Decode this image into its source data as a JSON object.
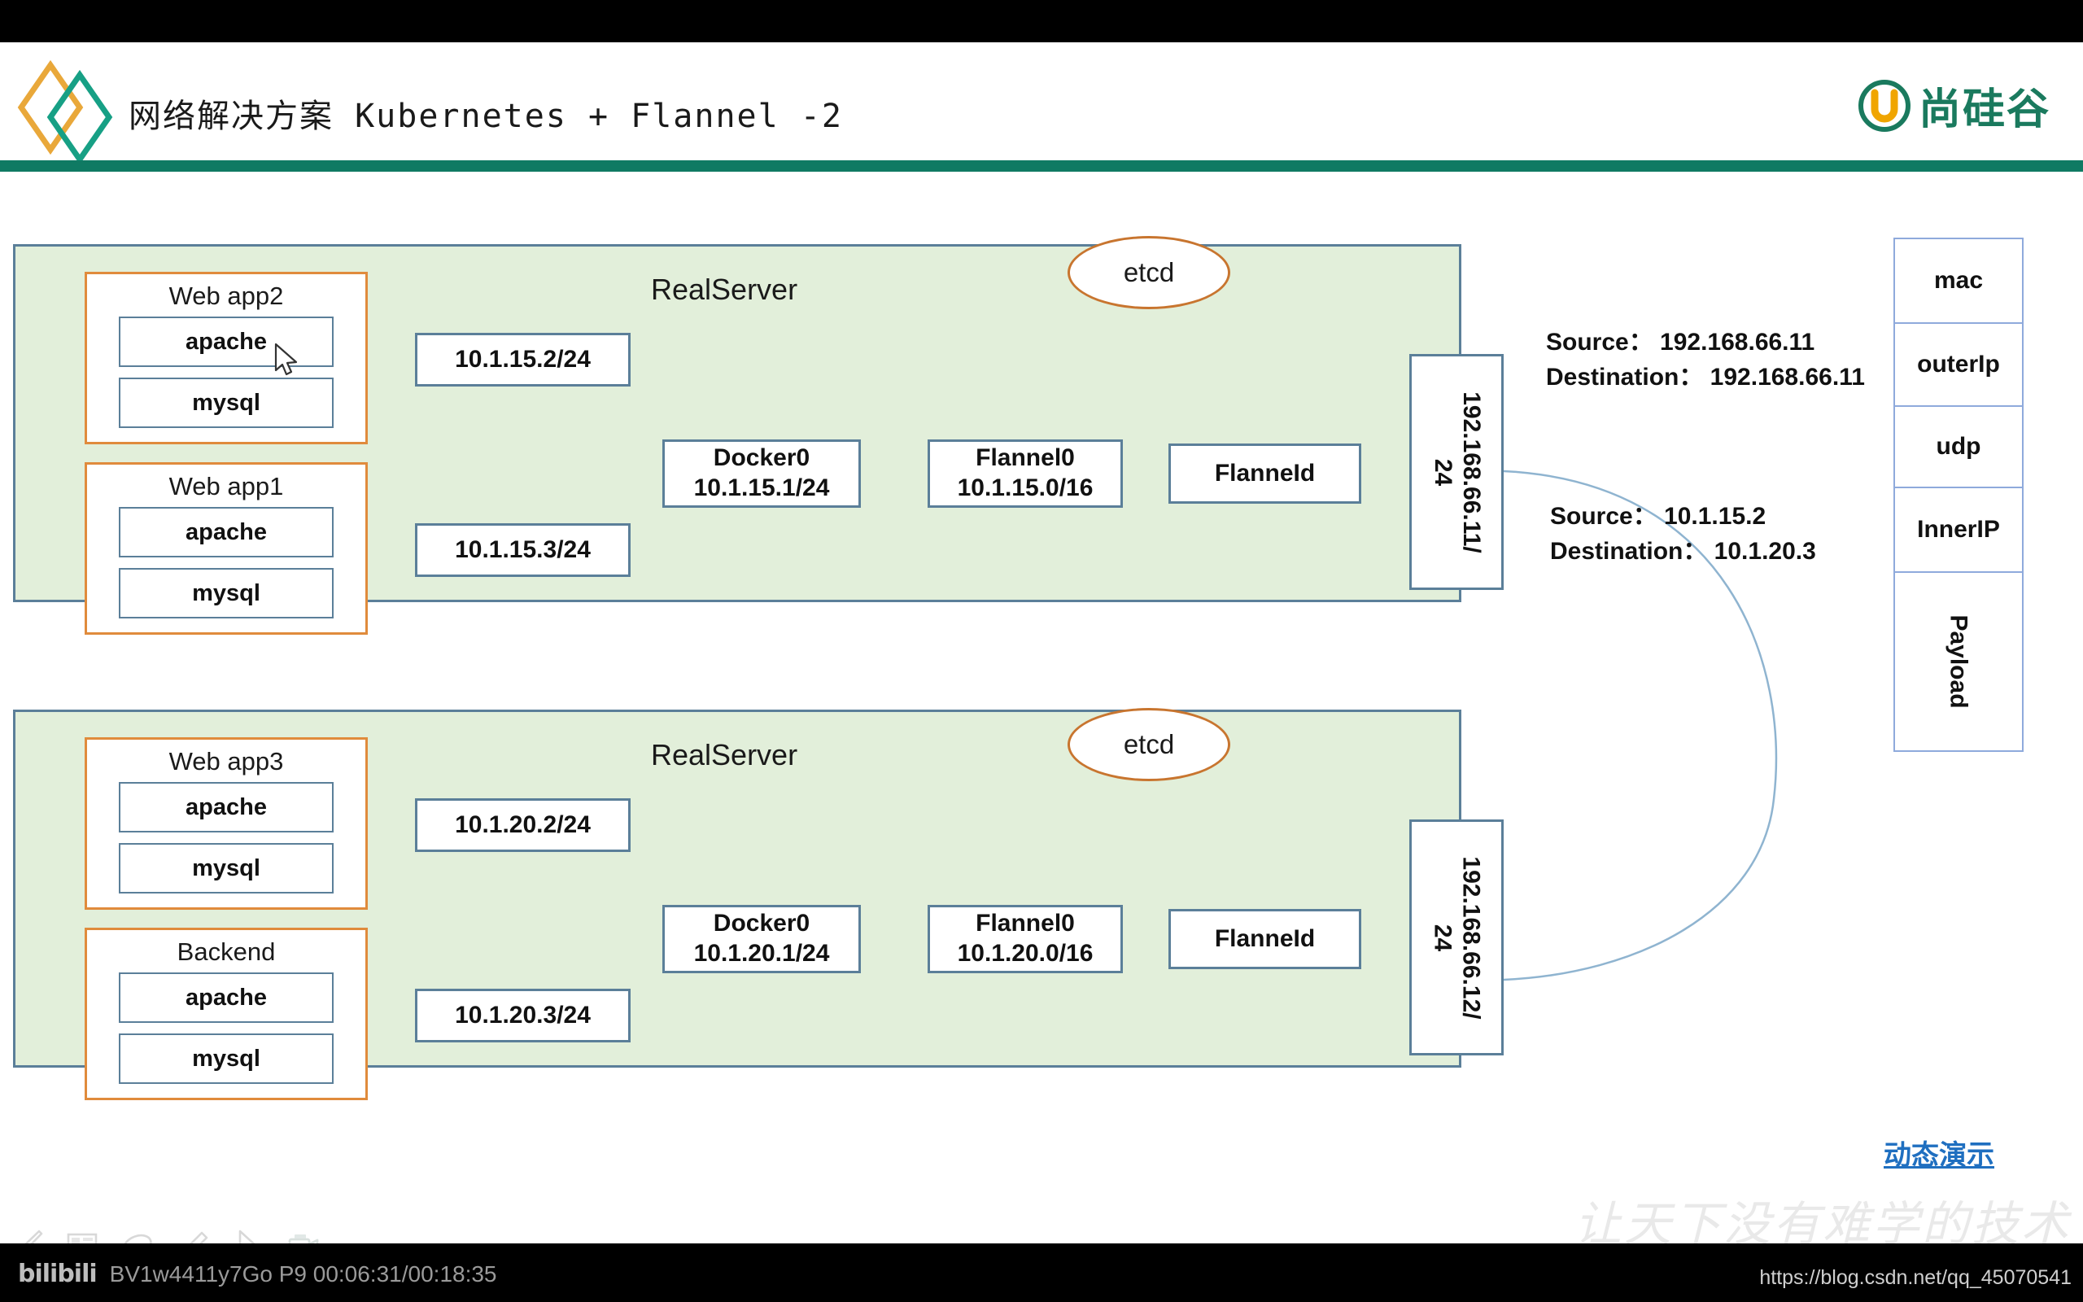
{
  "header": {
    "title": "网络解决方案 Kubernetes + Flannel -2",
    "brand": "尚硅谷",
    "logo_icon": "diamond-logo-icon",
    "brand_icon": "u-mark-icon"
  },
  "realservers": [
    {
      "title": "RealServer",
      "etcd_label": "etcd",
      "pods": [
        {
          "name": "Web app2",
          "services": [
            "apache",
            "mysql"
          ],
          "ip": "10.1.15.2/24"
        },
        {
          "name": "Web app1",
          "services": [
            "apache",
            "mysql"
          ],
          "ip": "10.1.15.3/24"
        }
      ],
      "docker": {
        "name": "Docker0",
        "cidr": "10.1.15.1/24"
      },
      "flannel0": {
        "name": "Flannel0",
        "cidr": "10.1.15.0/16"
      },
      "flanneld": "FlanneId",
      "host_ip_line1": "192.168.66.11/",
      "host_ip_line2": "24"
    },
    {
      "title": "RealServer",
      "etcd_label": "etcd",
      "pods": [
        {
          "name": "Web app3",
          "services": [
            "apache",
            "mysql"
          ],
          "ip": "10.1.20.2/24"
        },
        {
          "name": "Backend",
          "services": [
            "apache",
            "mysql"
          ],
          "ip": "10.1.20.3/24"
        }
      ],
      "docker": {
        "name": "Docker0",
        "cidr": "10.1.20.1/24"
      },
      "flannel0": {
        "name": "Flannel0",
        "cidr": "10.1.20.0/16"
      },
      "flanneld": "FlanneId",
      "host_ip_line1": "192.168.66.12/",
      "host_ip_line2": "24"
    }
  ],
  "annotations": {
    "outer": {
      "source_label": "Source：",
      "source_value": "192.168.66.11",
      "destination_label": "Destination：",
      "destination_value": "192.168.66.11",
      "line1": "Source： 192.168.66.11",
      "line2": "Destination： 192.168.66.11"
    },
    "inner": {
      "source_label": "Source：",
      "source_value": "10.1.15.2",
      "destination_label": "Destination：",
      "destination_value": "10.1.20.3",
      "line1": "Source： 10.1.15.2",
      "line2": "Destination： 10.1.20.3"
    }
  },
  "packet_stack": {
    "cells": [
      "mac",
      "outerIp",
      "udp",
      "InnerIP",
      "Payload"
    ]
  },
  "demo_link": "动态演示",
  "watermark": "让天下没有难学的技术",
  "toolbar": {
    "icons": [
      "pen-icon",
      "whiteboard-icon",
      "mouse-icon",
      "eraser-icon",
      "pointer-icon",
      "camera-icon"
    ]
  },
  "player": {
    "site": "bilibili",
    "video_id": "BV1w4411y7Go",
    "part": "P9",
    "time": "00:06:31/00:18:35",
    "status_text": "BV1w4411y7Go P9 00:06:31/00:18:35"
  },
  "source_url": "https://blog.csdn.net/qq_45070541",
  "colors": {
    "panel_fill": "#e2efda",
    "panel_border": "#5b7f99",
    "pod_border": "#e08b3c",
    "etcd_border": "#c8752f",
    "brand_green": "#1a7a5e",
    "rule_green": "#0f7a63",
    "link_blue": "#1f6fc0",
    "packet_border": "#8faadc",
    "connector": "#8fb4d0"
  }
}
